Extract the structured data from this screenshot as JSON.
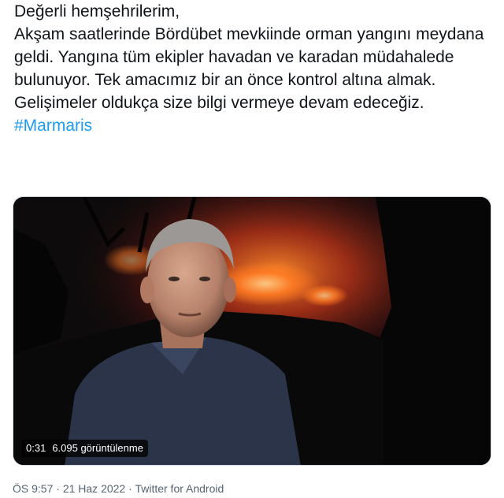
{
  "tweet": {
    "greeting": "Değerli hemşehrilerim,",
    "body": "Akşam saatlerinde Bördübet mevkiinde orman yangını meydana geldi. Yangına tüm ekipler havadan ve karadan müdahalede bulunuyor. Tek amacımız bir an önce kontrol altına almak. Gelişimeler oldukça size bilgi vermeye devam edeceğiz.",
    "hashtag": "#Marmaris"
  },
  "video": {
    "duration": "0:31",
    "views": "6.095 görüntülenme"
  },
  "meta": {
    "time": "ÖS 9:57",
    "separator1": " · ",
    "date": "21 Haz 2022",
    "separator2": " · ",
    "source": "Twitter for Android"
  },
  "colors": {
    "text": "#0f1419",
    "link": "#1d9bf0",
    "muted": "#536471"
  }
}
